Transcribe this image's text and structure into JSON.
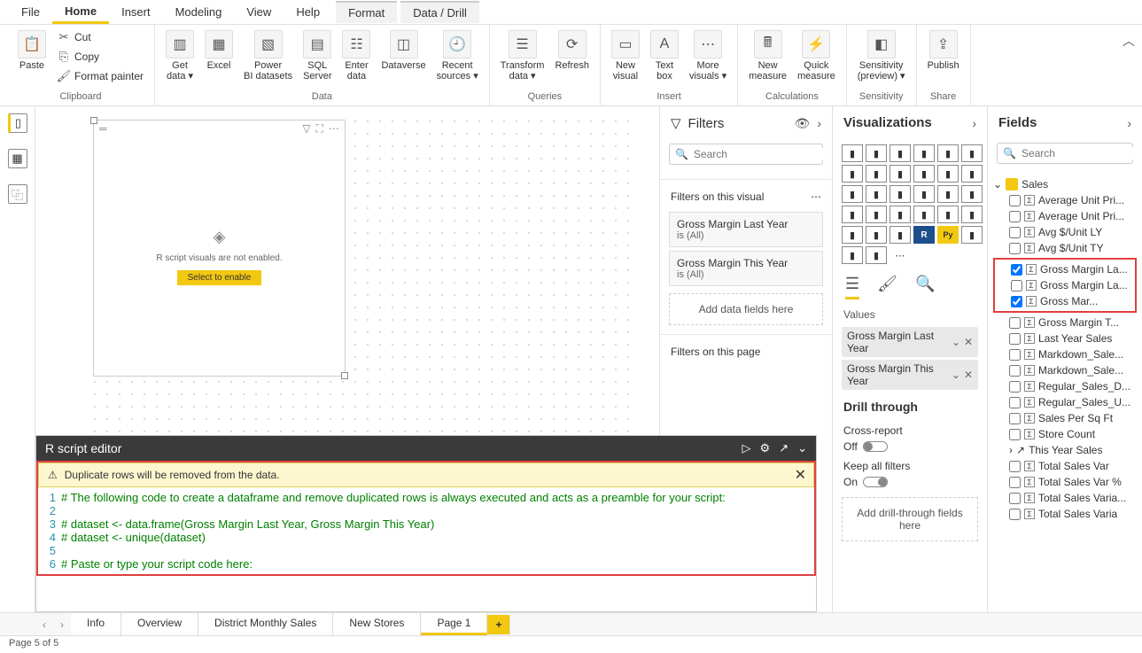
{
  "menubar": {
    "items": [
      "File",
      "Home",
      "Insert",
      "Modeling",
      "View",
      "Help",
      "Format",
      "Data / Drill"
    ],
    "active": 1,
    "contextual_start": 6
  },
  "ribbon": {
    "groups": [
      {
        "label": "Clipboard",
        "buttons": [
          {
            "key": "paste",
            "label": "Paste",
            "icon": "📋"
          }
        ],
        "smalls": [
          {
            "key": "cut",
            "label": "Cut",
            "icon": "✂"
          },
          {
            "key": "copy",
            "label": "Copy",
            "icon": "⎘"
          },
          {
            "key": "format_painter",
            "label": "Format painter",
            "icon": "🖌"
          }
        ]
      },
      {
        "label": "Data",
        "buttons": [
          {
            "key": "get_data",
            "label": "Get data ▾",
            "icon": "▥"
          },
          {
            "key": "excel",
            "label": "Excel",
            "icon": "▦"
          },
          {
            "key": "pbi_ds",
            "label": "Power BI datasets",
            "icon": "▧"
          },
          {
            "key": "sql",
            "label": "SQL Server",
            "icon": "▤"
          },
          {
            "key": "enter_data",
            "label": "Enter data",
            "icon": "☷"
          },
          {
            "key": "dataverse",
            "label": "Dataverse",
            "icon": "◫"
          },
          {
            "key": "recent",
            "label": "Recent sources ▾",
            "icon": "🕘"
          }
        ]
      },
      {
        "label": "Queries",
        "buttons": [
          {
            "key": "transform",
            "label": "Transform data ▾",
            "icon": "☰"
          },
          {
            "key": "refresh",
            "label": "Refresh",
            "icon": "⟳"
          }
        ]
      },
      {
        "label": "Insert",
        "buttons": [
          {
            "key": "new_visual",
            "label": "New visual",
            "icon": "▭"
          },
          {
            "key": "text_box",
            "label": "Text box",
            "icon": "A"
          },
          {
            "key": "more_visuals",
            "label": "More visuals ▾",
            "icon": "⋯"
          }
        ]
      },
      {
        "label": "Calculations",
        "buttons": [
          {
            "key": "new_measure",
            "label": "New measure",
            "icon": "🖩"
          },
          {
            "key": "quick_measure",
            "label": "Quick measure",
            "icon": "⚡"
          }
        ]
      },
      {
        "label": "Sensitivity",
        "buttons": [
          {
            "key": "sensitivity",
            "label": "Sensitivity (preview) ▾",
            "icon": "◧"
          }
        ]
      },
      {
        "label": "Share",
        "buttons": [
          {
            "key": "publish",
            "label": "Publish",
            "icon": "⇪"
          }
        ]
      }
    ]
  },
  "canvas": {
    "visual_msg": "R script visuals are not enabled.",
    "visual_btn": "Select to enable"
  },
  "filters": {
    "title": "Filters",
    "search_placeholder": "Search",
    "section1_title": "Filters on this visual",
    "cards": [
      {
        "name": "Gross Margin Last Year",
        "state": "is (All)"
      },
      {
        "name": "Gross Margin This Year",
        "state": "is (All)"
      }
    ],
    "add_fields": "Add data fields here",
    "section2_title": "Filters on this page"
  },
  "viz": {
    "title": "Visualizations",
    "values_label": "Values",
    "pills": [
      {
        "label": "Gross Margin Last Year"
      },
      {
        "label": "Gross Margin This Year"
      }
    ],
    "drill_title": "Drill through",
    "cross": "Cross-report",
    "off": "Off",
    "keep": "Keep all filters",
    "on": "On",
    "add_drill": "Add drill-through fields here"
  },
  "fields": {
    "title": "Fields",
    "search_placeholder": "Search",
    "table": "Sales",
    "items": [
      {
        "label": "Average Unit Pri...",
        "checked": false
      },
      {
        "label": "Average Unit Pri...",
        "checked": false
      },
      {
        "label": "Avg $/Unit LY",
        "checked": false
      },
      {
        "label": "Avg $/Unit TY",
        "checked": false
      },
      {
        "label": "Gross Margin La...",
        "checked": true,
        "hl": true
      },
      {
        "label": "Gross Margin La...",
        "checked": false,
        "hl": true
      },
      {
        "label": "Gross Mar...",
        "checked": true,
        "hl": true
      },
      {
        "label": "Gross Margin T...",
        "checked": false
      },
      {
        "label": "Last Year Sales",
        "checked": false
      },
      {
        "label": "Markdown_Sale...",
        "checked": false
      },
      {
        "label": "Markdown_Sale...",
        "checked": false
      },
      {
        "label": "Regular_Sales_D...",
        "checked": false
      },
      {
        "label": "Regular_Sales_U...",
        "checked": false
      },
      {
        "label": "Sales Per Sq Ft",
        "checked": false
      },
      {
        "label": "Store Count",
        "checked": false
      },
      {
        "label": "This Year Sales",
        "checked": false,
        "hier": true
      },
      {
        "label": "Total Sales Var",
        "checked": false
      },
      {
        "label": "Total Sales Var %",
        "checked": false
      },
      {
        "label": "Total Sales Varia...",
        "checked": false
      },
      {
        "label": "Total Sales Varia",
        "checked": false
      }
    ]
  },
  "r_editor": {
    "title": "R script editor",
    "warning": "Duplicate rows will be removed from the data.",
    "lines": [
      "# The following code to create a dataframe and remove duplicated rows is always executed and acts as a preamble for your script:",
      "",
      "# dataset <- data.frame(Gross Margin Last Year, Gross Margin This Year)",
      "# dataset <- unique(dataset)",
      "",
      "# Paste or type your script code here:"
    ]
  },
  "page_tabs": {
    "tabs": [
      "Info",
      "Overview",
      "District Monthly Sales",
      "New Stores",
      "Page 1"
    ],
    "active": 4
  },
  "status": "Page 5 of 5"
}
